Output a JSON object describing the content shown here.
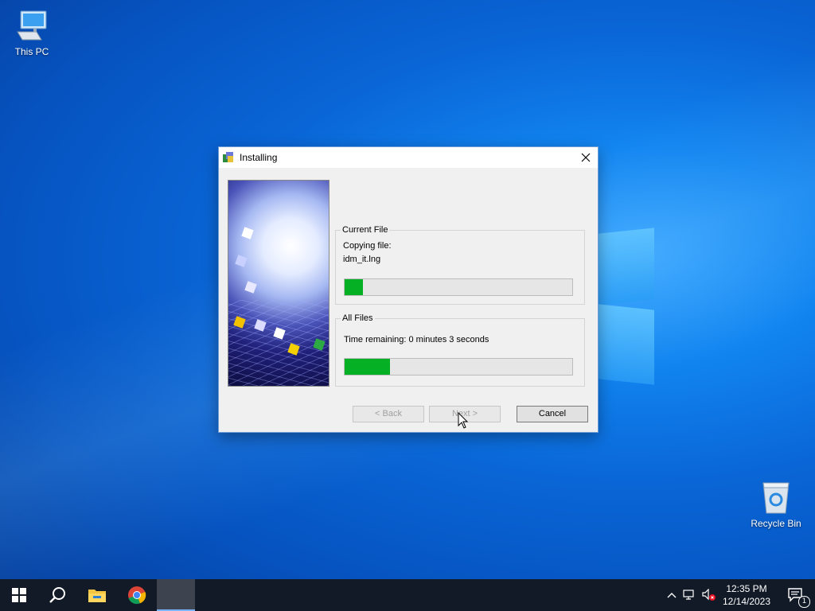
{
  "desktop": {
    "icons": [
      {
        "label": "This PC",
        "icon": "this-pc-icon"
      },
      {
        "label": "Recycle Bin",
        "icon": "recycle-bin-icon"
      }
    ]
  },
  "dialog": {
    "title": "Installing",
    "current_file": {
      "legend": "Current File",
      "action": "Copying file:",
      "filename": "idm_it.lng",
      "progress": 0.08
    },
    "all_files": {
      "legend": "All Files",
      "time_remaining": "Time remaining: 0 minutes 3 seconds",
      "progress": 0.2
    },
    "buttons": {
      "back": "< Back",
      "next": "Next >",
      "cancel": "Cancel"
    }
  },
  "taskbar": {
    "items": [
      "start-icon",
      "search-icon",
      "file-explorer-icon",
      "chrome-icon",
      "installer-app"
    ],
    "clock": {
      "time": "12:35 PM",
      "date": "12/14/2023"
    },
    "notifications_count": "1"
  },
  "colors": {
    "progress_fill": "#06b025",
    "taskbar": "#111a26"
  }
}
